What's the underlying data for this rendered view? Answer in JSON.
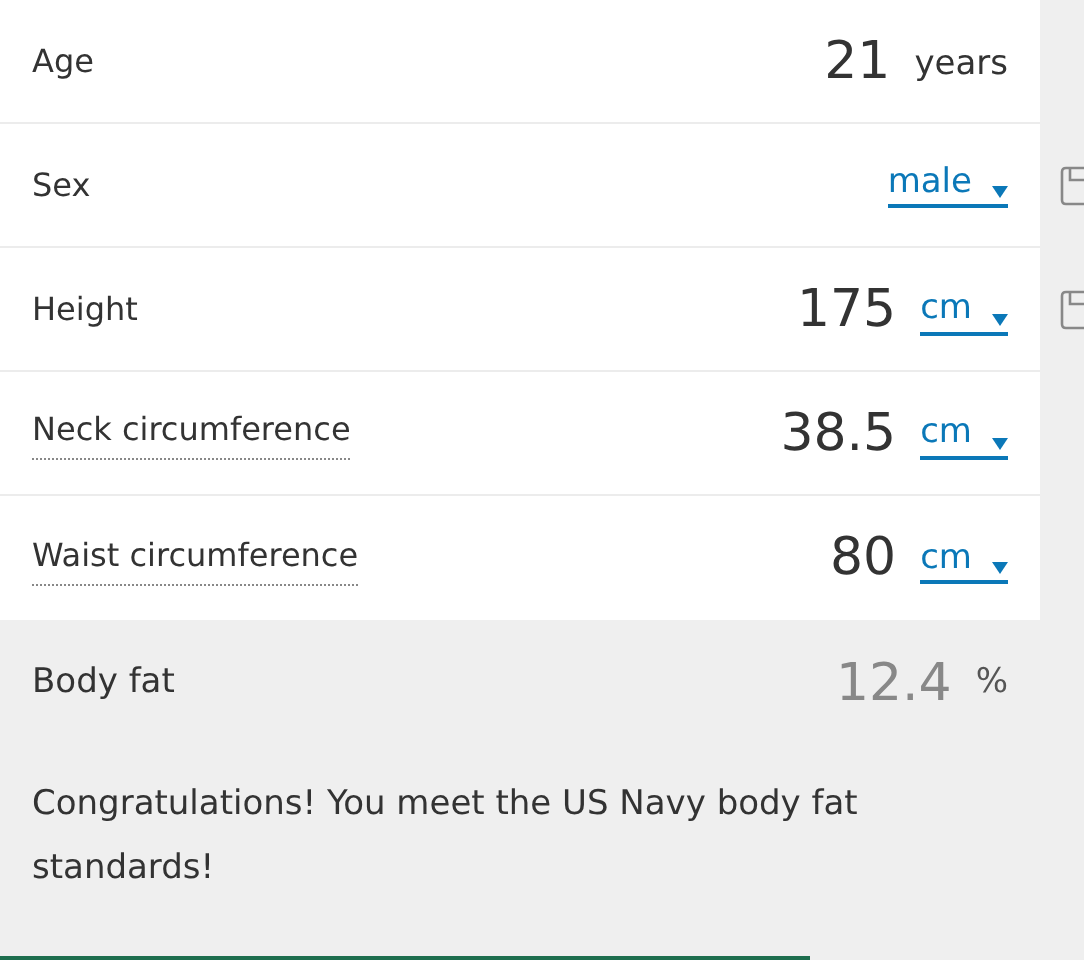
{
  "fields": [
    {
      "label": "Age",
      "hinted": false,
      "value": "21",
      "unit": "years",
      "kind": "text",
      "saveable": false
    },
    {
      "label": "Sex",
      "hinted": false,
      "unit": "male",
      "kind": "select",
      "saveable": true
    },
    {
      "label": "Height",
      "hinted": false,
      "value": "175",
      "unit": "cm",
      "kind": "select",
      "saveable": true
    },
    {
      "label": "Neck circumference",
      "hinted": true,
      "value": "38.5",
      "unit": "cm",
      "kind": "select",
      "saveable": false
    },
    {
      "label": "Waist circumference",
      "hinted": true,
      "value": "80",
      "unit": "cm",
      "kind": "select",
      "saveable": false
    }
  ],
  "result": {
    "label": "Body fat",
    "value": "12.4",
    "unit": "%"
  },
  "message": "Congratulations! You meet the US Navy body fat standards!"
}
